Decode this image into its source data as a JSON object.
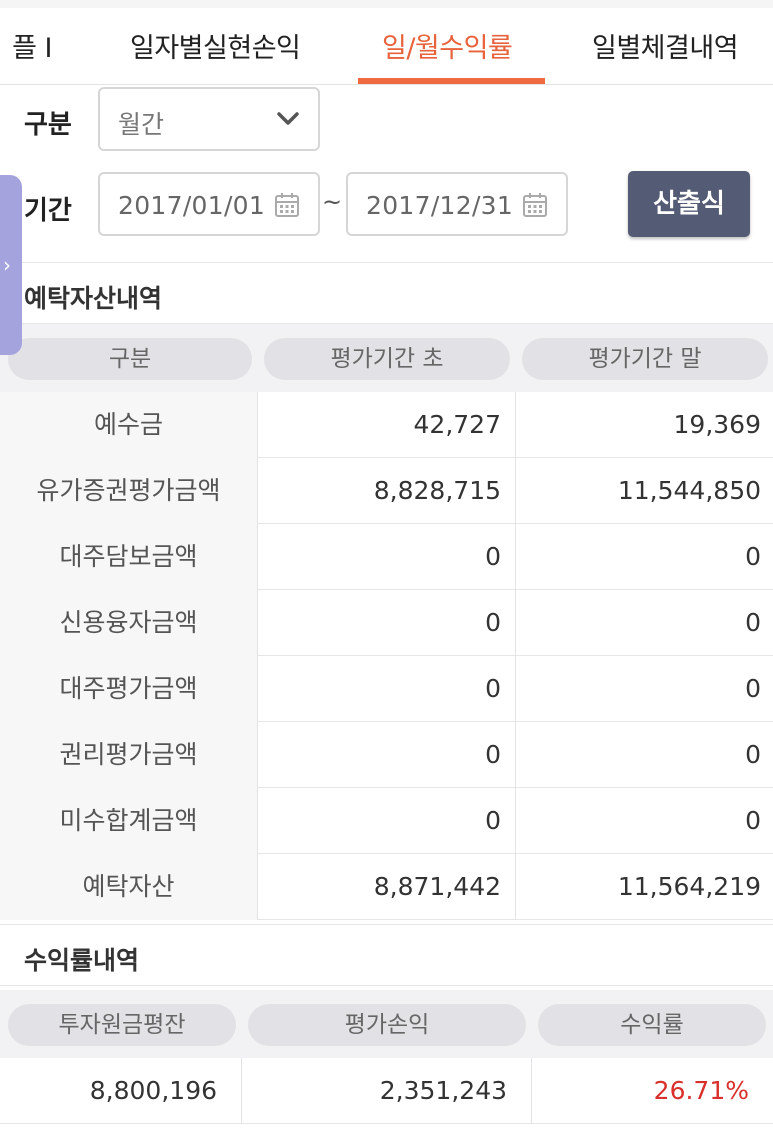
{
  "tabs": [
    {
      "label": "플 I",
      "active": false
    },
    {
      "label": "일자별실현손익",
      "active": false
    },
    {
      "label": "일/월수익률",
      "active": true
    },
    {
      "label": "일별체결내역",
      "active": false
    }
  ],
  "filters": {
    "category_label": "구분",
    "category_value": "월간",
    "period_label": "기간",
    "start_date": "2017/01/01",
    "end_date": "2017/12/31",
    "range_sep": "~",
    "submit_label": "산출식"
  },
  "deposit": {
    "title": "예탁자산내역",
    "headers": [
      "구분",
      "평가기간 초",
      "평가기간 말"
    ],
    "rows": [
      {
        "label": "예수금",
        "begin": "42,727",
        "end": "19,369"
      },
      {
        "label": "유가증권평가금액",
        "begin": "8,828,715",
        "end": "11,544,850"
      },
      {
        "label": "대주담보금액",
        "begin": "0",
        "end": "0"
      },
      {
        "label": "신용융자금액",
        "begin": "0",
        "end": "0"
      },
      {
        "label": "대주평가금액",
        "begin": "0",
        "end": "0"
      },
      {
        "label": "권리평가금액",
        "begin": "0",
        "end": "0"
      },
      {
        "label": "미수합계금액",
        "begin": "0",
        "end": "0"
      },
      {
        "label": "예탁자산",
        "begin": "8,871,442",
        "end": "11,564,219"
      }
    ]
  },
  "returns": {
    "title": "수익률내역",
    "headers": [
      "투자원금평잔",
      "평가손익",
      "수익률"
    ],
    "values": {
      "principal": "8,800,196",
      "pnl": "2,351,243",
      "rate": "26.71%"
    }
  },
  "colors": {
    "accent": "#ef6a3e",
    "button": "#545b74",
    "negative_red": "#d9302b",
    "side_handle": "#a5a3dd"
  },
  "icons": {
    "dropdown": "chevron-down-icon",
    "calendar": "calendar-icon",
    "side": "chevron-right-icon"
  }
}
